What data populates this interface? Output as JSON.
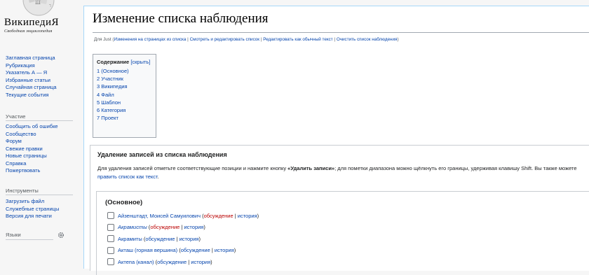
{
  "logo": {
    "title": "ВикипедиЯ",
    "tagline": "Свободная энциклопедия"
  },
  "nav_main": [
    "Заглавная страница",
    "Рубрикация",
    "Указатель А — Я",
    "Избранные статьи",
    "Случайная страница",
    "Текущие события"
  ],
  "nav_participation": {
    "heading": "Участие",
    "items": [
      "Сообщить об ошибке",
      "Сообщество",
      "Форум",
      "Свежие правки",
      "Новые страницы",
      "Справка",
      "Пожертвовать"
    ]
  },
  "nav_tools": {
    "heading": "Инструменты",
    "items": [
      "Загрузить файл",
      "Служебные страницы",
      "Версия для печати"
    ]
  },
  "nav_languages": {
    "heading": "Языки"
  },
  "page": {
    "title": "Изменение списка наблюдения",
    "subtitle": {
      "prefix": "Для Just (",
      "links": [
        "Изменения на страницах из списка",
        "Смотреть и редактировать список",
        "Редактировать как обычный текст",
        "Очистить список наблюдения"
      ],
      "separator": " | ",
      "suffix": ")"
    }
  },
  "toc": {
    "title": "Содержание",
    "toggle": "[скрыть]",
    "items": [
      "1 (Основное)",
      "2 Участник",
      "3 Википедия",
      "4 Файл",
      "5 Шаблон",
      "6 Категория",
      "7 Проект"
    ]
  },
  "form": {
    "title": "Удаление записей из списка наблюдения",
    "desc_part1": "Для удаления записей отметьте соответствующие позиции и нажмите кнопку ",
    "desc_bold": "«Удалить записи»",
    "desc_part2": "; для пометки диапазона можно щёлкнуть его границы, удерживая клавишу Shift. Вы также можете ",
    "desc_link": "править список как текст",
    "desc_end": "."
  },
  "namespace": {
    "title": "(Основное)",
    "talk_label": "обсуждение",
    "history_label": "история",
    "items": [
      {
        "title": "Айзенштадт, Моисей Самуилович",
        "talk_red": true,
        "italic": false
      },
      {
        "title": "Акрамисты",
        "talk_red": true,
        "italic": true
      },
      {
        "title": "Акрамиты",
        "talk_red": false,
        "italic": false
      },
      {
        "title": "Акташ (горная вершина)",
        "talk_red": false,
        "italic": false
      },
      {
        "title": "Актепа (канал)",
        "talk_red": false,
        "italic": false
      }
    ]
  },
  "colors": {
    "link": "#0645ad",
    "redlink": "#ba0000",
    "border": "#a7d7f9"
  }
}
